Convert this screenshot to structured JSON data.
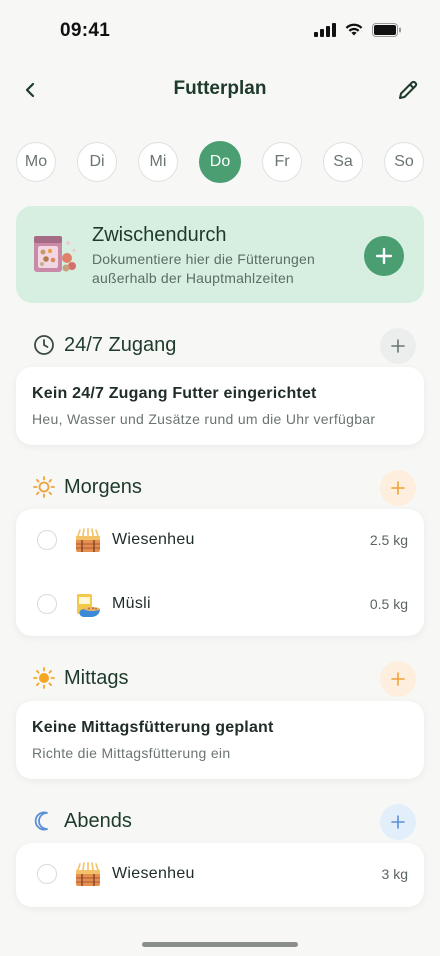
{
  "status": {
    "time": "09:41"
  },
  "nav": {
    "title": "Futterplan"
  },
  "days": [
    {
      "label": "Mo",
      "active": false
    },
    {
      "label": "Di",
      "active": false
    },
    {
      "label": "Mi",
      "active": false
    },
    {
      "label": "Do",
      "active": true
    },
    {
      "label": "Fr",
      "active": false
    },
    {
      "label": "Sa",
      "active": false
    },
    {
      "label": "So",
      "active": false
    }
  ],
  "snack": {
    "title": "Zwischendurch",
    "description": "Dokumentiere hier die Fütterungen außerhalb der Hauptmahlzeiten"
  },
  "sections": {
    "access": {
      "title": "24/7 Zugang",
      "empty_title": "Kein 24/7 Zugang Futter eingerichtet",
      "empty_sub": "Heu, Wasser und Zusätze rund um die Uhr verfügbar"
    },
    "morning": {
      "title": "Morgens",
      "items": [
        {
          "name": "Wiesenheu",
          "amount": "2.5 kg",
          "icon": "hay-bale-icon"
        },
        {
          "name": "Müsli",
          "amount": "0.5 kg",
          "icon": "muesli-bag-icon"
        }
      ]
    },
    "noon": {
      "title": "Mittags",
      "empty_title": "Keine Mittagsfütterung geplant",
      "empty_sub": "Richte die Mittagsfütterung ein"
    },
    "evening": {
      "title": "Abends",
      "items": [
        {
          "name": "Wiesenheu",
          "amount": "3 kg",
          "icon": "hay-bale-icon"
        }
      ]
    }
  },
  "colors": {
    "accent": "#4a9e72",
    "snack_bg": "#d7efe1",
    "morning_tint": "#fdeedd",
    "noon_tint": "#fdeedd",
    "evening_tint": "#e3eefb",
    "access_tint": "#eceeed"
  }
}
